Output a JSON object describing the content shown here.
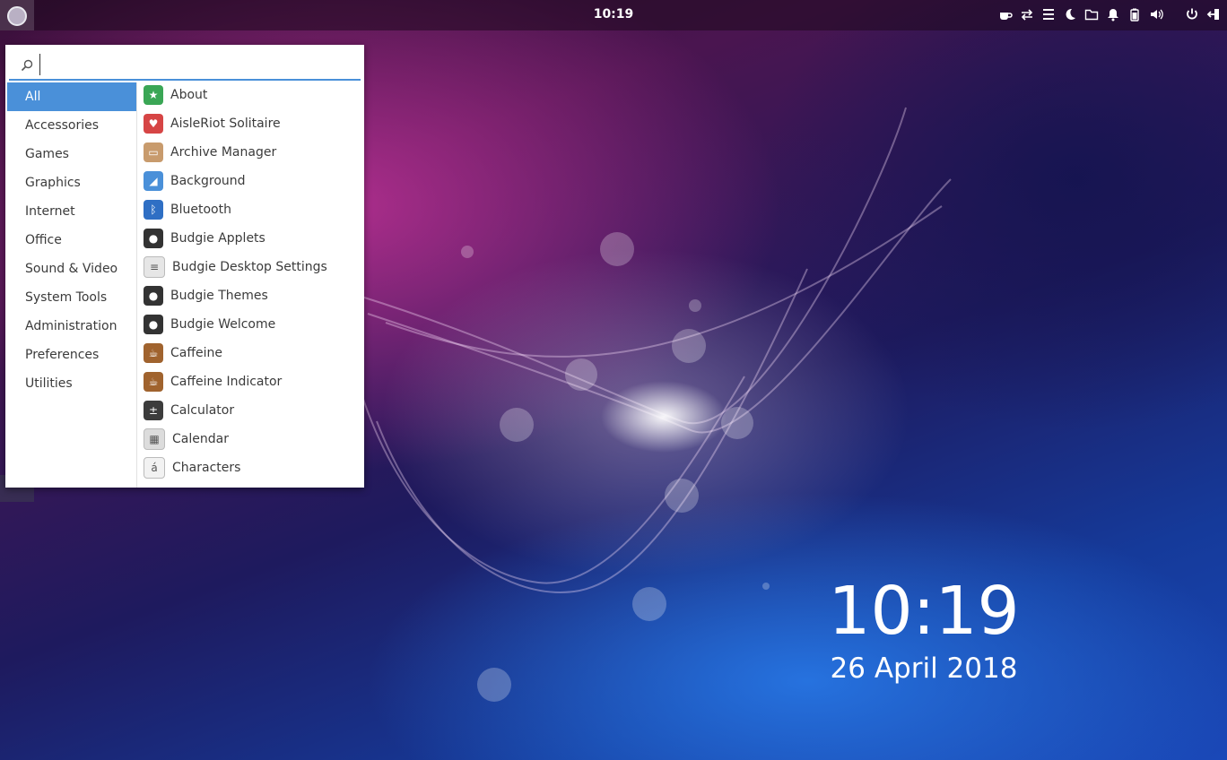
{
  "panel": {
    "clock": "10:19",
    "tray_icons": [
      "coffee-icon",
      "network-arrows-icon",
      "menu-icon",
      "night-mode-icon",
      "folder-icon",
      "notification-bell-icon",
      "battery-icon",
      "volume-icon",
      "power-icon",
      "logout-icon"
    ]
  },
  "menu": {
    "search_value": "",
    "categories": [
      {
        "label": "All",
        "active": true
      },
      {
        "label": "Accessories"
      },
      {
        "label": "Games"
      },
      {
        "label": "Graphics"
      },
      {
        "label": "Internet"
      },
      {
        "label": "Office"
      },
      {
        "label": "Sound & Video"
      },
      {
        "label": "System Tools"
      },
      {
        "label": "Administration"
      },
      {
        "label": "Preferences"
      },
      {
        "label": "Utilities"
      }
    ],
    "apps": [
      {
        "label": "About",
        "icon": "star-icon",
        "color": "#3aa655"
      },
      {
        "label": "AisleRiot Solitaire",
        "icon": "heart-card-icon",
        "color": "#d64545"
      },
      {
        "label": "Archive Manager",
        "icon": "archive-icon",
        "color": "#c89b6d"
      },
      {
        "label": "Background",
        "icon": "background-icon",
        "color": "#4a90d9"
      },
      {
        "label": "Bluetooth",
        "icon": "bluetooth-icon",
        "color": "#2f6fc4"
      },
      {
        "label": "Budgie Applets",
        "icon": "budgie-icon",
        "color": "#333333"
      },
      {
        "label": "Budgie Desktop Settings",
        "icon": "settings-toggle-icon",
        "color": "#e6e6e6"
      },
      {
        "label": "Budgie Themes",
        "icon": "budgie-icon",
        "color": "#333333"
      },
      {
        "label": "Budgie Welcome",
        "icon": "budgie-icon",
        "color": "#333333"
      },
      {
        "label": "Caffeine",
        "icon": "coffee-cup-icon",
        "color": "#a0632e"
      },
      {
        "label": "Caffeine Indicator",
        "icon": "coffee-cup-icon",
        "color": "#a0632e"
      },
      {
        "label": "Calculator",
        "icon": "calculator-icon",
        "color": "#3c3c3c"
      },
      {
        "label": "Calendar",
        "icon": "calendar-icon",
        "color": "#dcdcdc"
      },
      {
        "label": "Characters",
        "icon": "characters-icon",
        "color": "#f2f2f2"
      }
    ]
  },
  "desktop_clock": {
    "time": "10:19",
    "date": "26 April 2018"
  }
}
